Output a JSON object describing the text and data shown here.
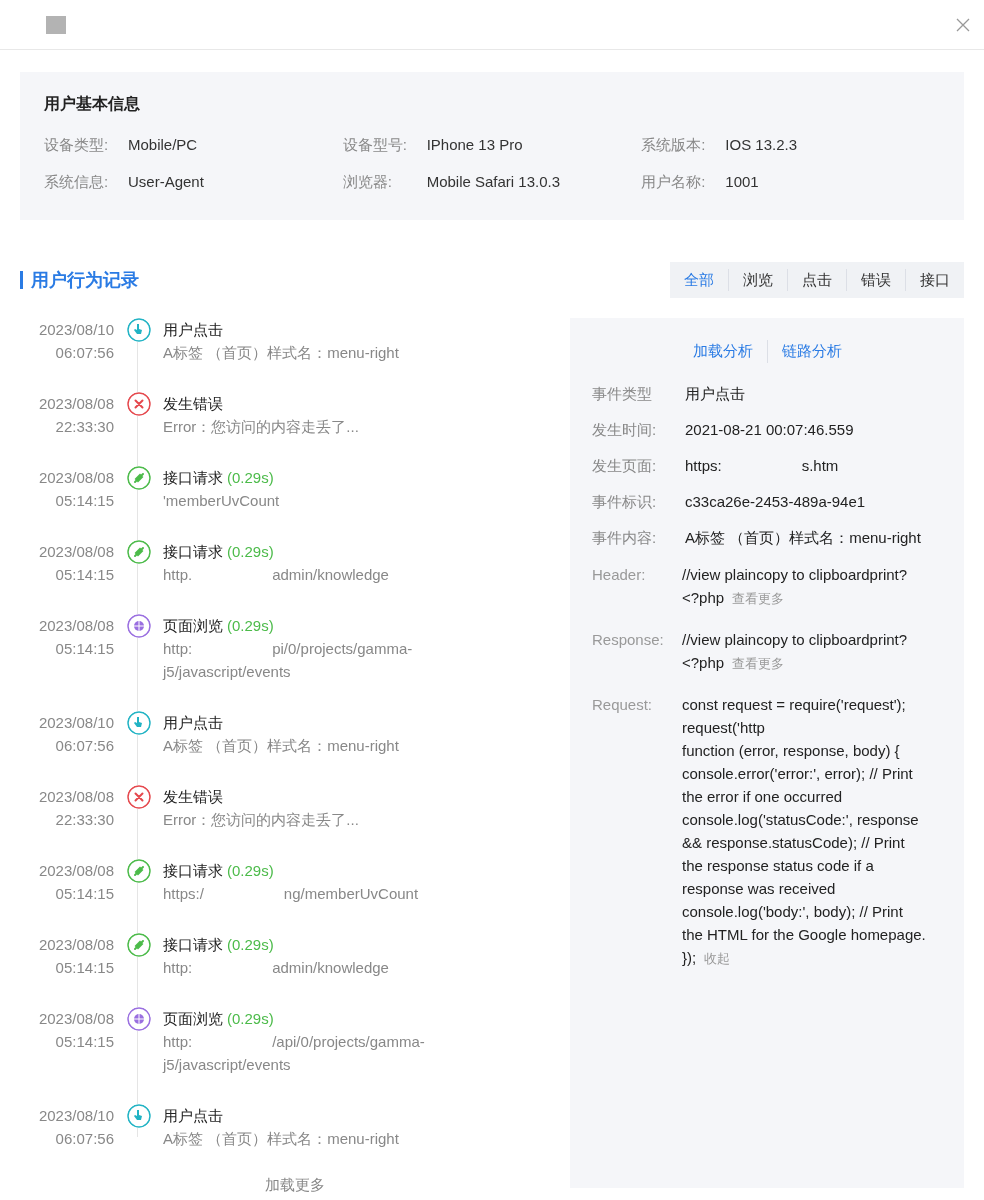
{
  "info": {
    "title": "用户基本信息",
    "fields": [
      {
        "label": "设备类型:",
        "value": "Mobile/PC"
      },
      {
        "label": "设备型号:",
        "value": "IPhone 13 Pro"
      },
      {
        "label": "系统版本:",
        "value": "IOS 13.2.3"
      },
      {
        "label": "系统信息:",
        "value": "User-Agent"
      },
      {
        "label": "浏览器:",
        "value": "Mobile Safari 13.0.3"
      },
      {
        "label": "用户名称:",
        "value": "1001"
      }
    ]
  },
  "section_title": "用户行为记录",
  "filters": [
    {
      "label": "全部",
      "selected": true
    },
    {
      "label": "浏览",
      "selected": false
    },
    {
      "label": "点击",
      "selected": false
    },
    {
      "label": "错误",
      "selected": false
    },
    {
      "label": "接口",
      "selected": false
    }
  ],
  "events": [
    {
      "kind": "click",
      "date": "2023/08/10",
      "time": "06:07:56",
      "title": "用户点击",
      "detail": [
        "A标签 （首页）样式名：menu-right"
      ]
    },
    {
      "kind": "error",
      "date": "2023/08/08",
      "time": "22:33:30",
      "title": "发生错误",
      "detail": [
        "Error：您访问的内容走丢了..."
      ]
    },
    {
      "kind": "api",
      "date": "2023/08/08",
      "time": "05:14:15",
      "title": "接口请求",
      "duration": "(0.29s)",
      "detail": [
        "'memberUvCount"
      ]
    },
    {
      "kind": "api",
      "date": "2023/08/08",
      "time": "05:14:15",
      "title": "接口请求",
      "duration": "(0.29s)",
      "detail": [
        "http.",
        "admin/knowledge"
      ]
    },
    {
      "kind": "page",
      "date": "2023/08/08",
      "time": "05:14:15",
      "title": "页面浏览",
      "duration": "(0.29s)",
      "detail": [
        "http:",
        "pi/0/projects/gamma-"
      ],
      "detail_more": "j5/javascript/events"
    },
    {
      "kind": "click",
      "date": "2023/08/10",
      "time": "06:07:56",
      "title": "用户点击",
      "detail": [
        "A标签 （首页）样式名：menu-right"
      ]
    },
    {
      "kind": "error",
      "date": "2023/08/08",
      "time": "22:33:30",
      "title": "发生错误",
      "detail": [
        "Error：您访问的内容走丢了..."
      ]
    },
    {
      "kind": "api",
      "date": "2023/08/08",
      "time": "05:14:15",
      "title": "接口请求",
      "duration": "(0.29s)",
      "detail": [
        "https:/",
        "ng/memberUvCount"
      ]
    },
    {
      "kind": "api",
      "date": "2023/08/08",
      "time": "05:14:15",
      "title": "接口请求",
      "duration": "(0.29s)",
      "detail": [
        "http:",
        "admin/knowledge"
      ]
    },
    {
      "kind": "page",
      "date": "2023/08/08",
      "time": "05:14:15",
      "title": "页面浏览",
      "duration": "(0.29s)",
      "detail": [
        "http:",
        "/api/0/projects/gamma-"
      ],
      "detail_more": "j5/javascript/events"
    },
    {
      "kind": "click",
      "date": "2023/08/10",
      "time": "06:07:56",
      "title": "用户点击",
      "detail": [
        "A标签 （首页）样式名：menu-right"
      ]
    }
  ],
  "load_more": "加载更多",
  "detail_panel": {
    "tabs": [
      "加载分析",
      "链路分析"
    ],
    "rows": [
      {
        "label": "事件类型",
        "value": [
          "用户点击"
        ]
      },
      {
        "label": "发生时间:",
        "value": [
          "2021-08-21 00:07:46.559"
        ]
      },
      {
        "label": "发生页面:",
        "value": [
          "https:",
          "s.htm"
        ]
      },
      {
        "label": "事件标识:",
        "value": [
          "c33ca26e-2453-489a-94e1"
        ]
      },
      {
        "label": "事件内容:",
        "value": [
          "A标签 （首页）样式名：menu-right"
        ]
      }
    ],
    "code_rows": [
      {
        "label": "Header:",
        "text": [
          "//view plaincopy to clipboardprint?",
          "<?php"
        ],
        "toggle": "查看更多"
      },
      {
        "label": "Response:",
        "text": [
          "//view plaincopy to clipboardprint?",
          "<?php"
        ],
        "toggle": "查看更多"
      },
      {
        "label": "Request:",
        "text": [
          "const request = require('request');",
          "request('http",
          "function (error, response, body) {",
          "console.error('error:', error); // Print",
          "the error if one occurred",
          "console.log('statusCode:', response",
          "&& response.statusCode); // Print",
          "the response status code if a",
          "response was received",
          "console.log('body:', body); // Print",
          "the HTML for the Google homepage.",
          "});"
        ],
        "toggle": "收起"
      }
    ]
  }
}
